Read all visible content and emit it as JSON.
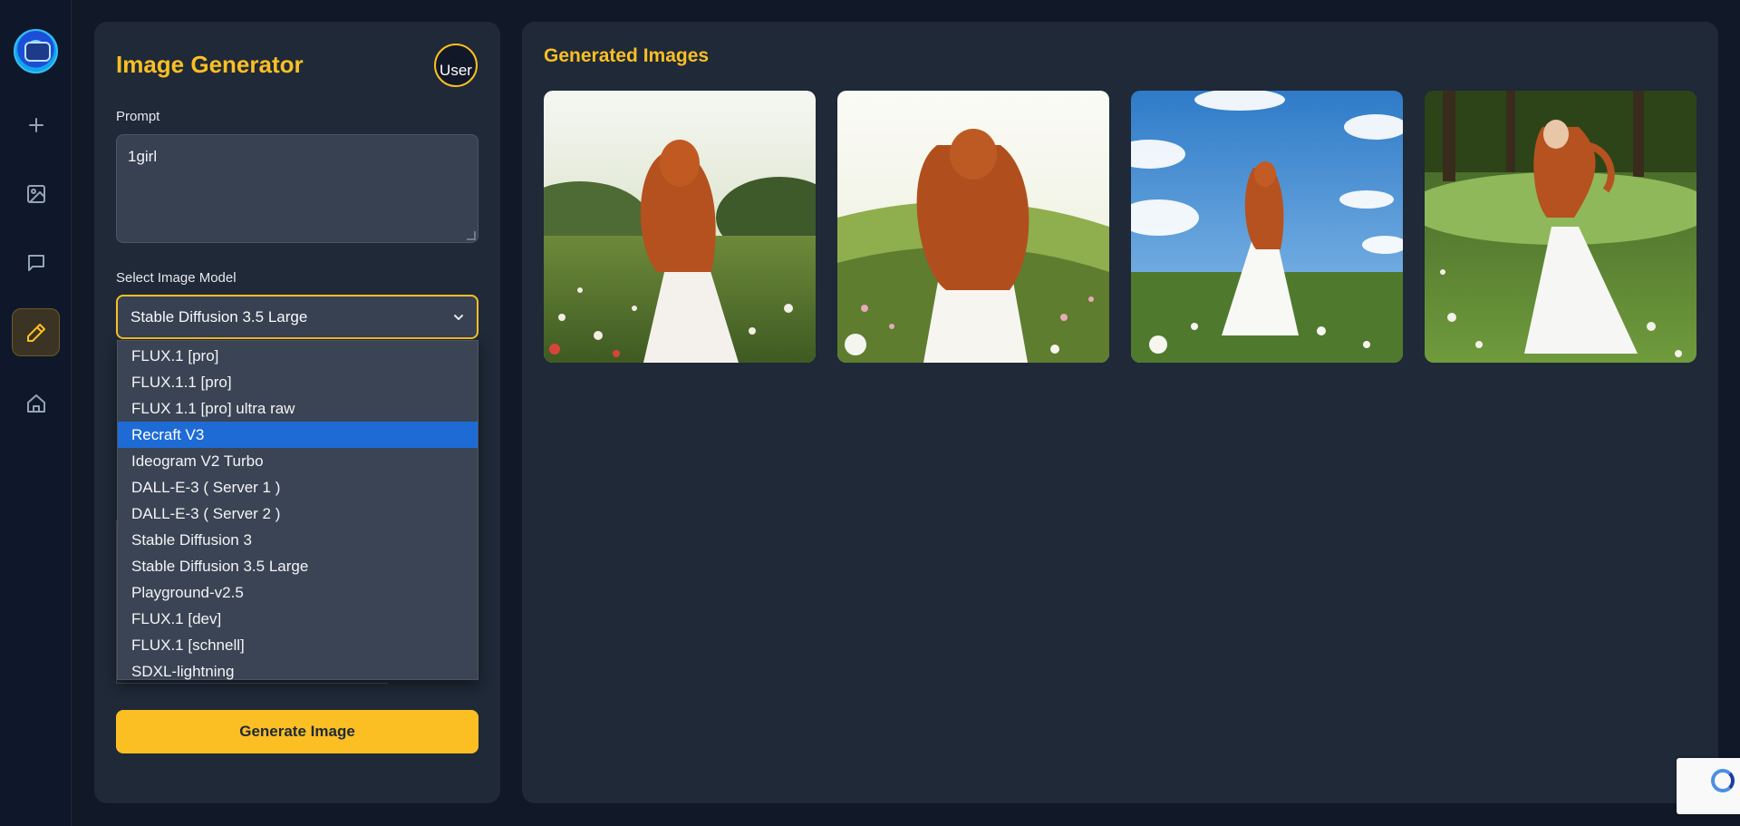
{
  "sidebar": {
    "icons": [
      "logo",
      "plus-icon",
      "image-icon",
      "chat-icon",
      "pencil-icon",
      "home-icon"
    ]
  },
  "generator": {
    "title": "Image Generator",
    "avatar_alt": "User",
    "prompt_label": "Prompt",
    "prompt_value": "1girl",
    "model_label": "Select Image Model",
    "model_selected": "Stable Diffusion 3.5 Large",
    "model_options": [
      "FLUX.1 [pro]",
      "FLUX.1.1 [pro]",
      "FLUX 1.1 [pro] ultra raw",
      "Recraft V3",
      "Ideogram V2 Turbo",
      "DALL-E-3 ( Server 1 )",
      "DALL-E-3 ( Server 2 )",
      "Stable Diffusion 3",
      "Stable Diffusion 3.5 Large",
      "Playground-v2.5",
      "FLUX.1 [dev]",
      "FLUX.1 [schnell]",
      "SDXL-lightning"
    ],
    "highlighted_option": "Recraft V3",
    "generate_label": "Generate Image"
  },
  "results": {
    "title": "Generated Images",
    "image_count": 4
  },
  "colors": {
    "accent": "#fbbf24",
    "panel": "#1f2937",
    "background": "#111827",
    "highlight": "#1e6bd6"
  }
}
